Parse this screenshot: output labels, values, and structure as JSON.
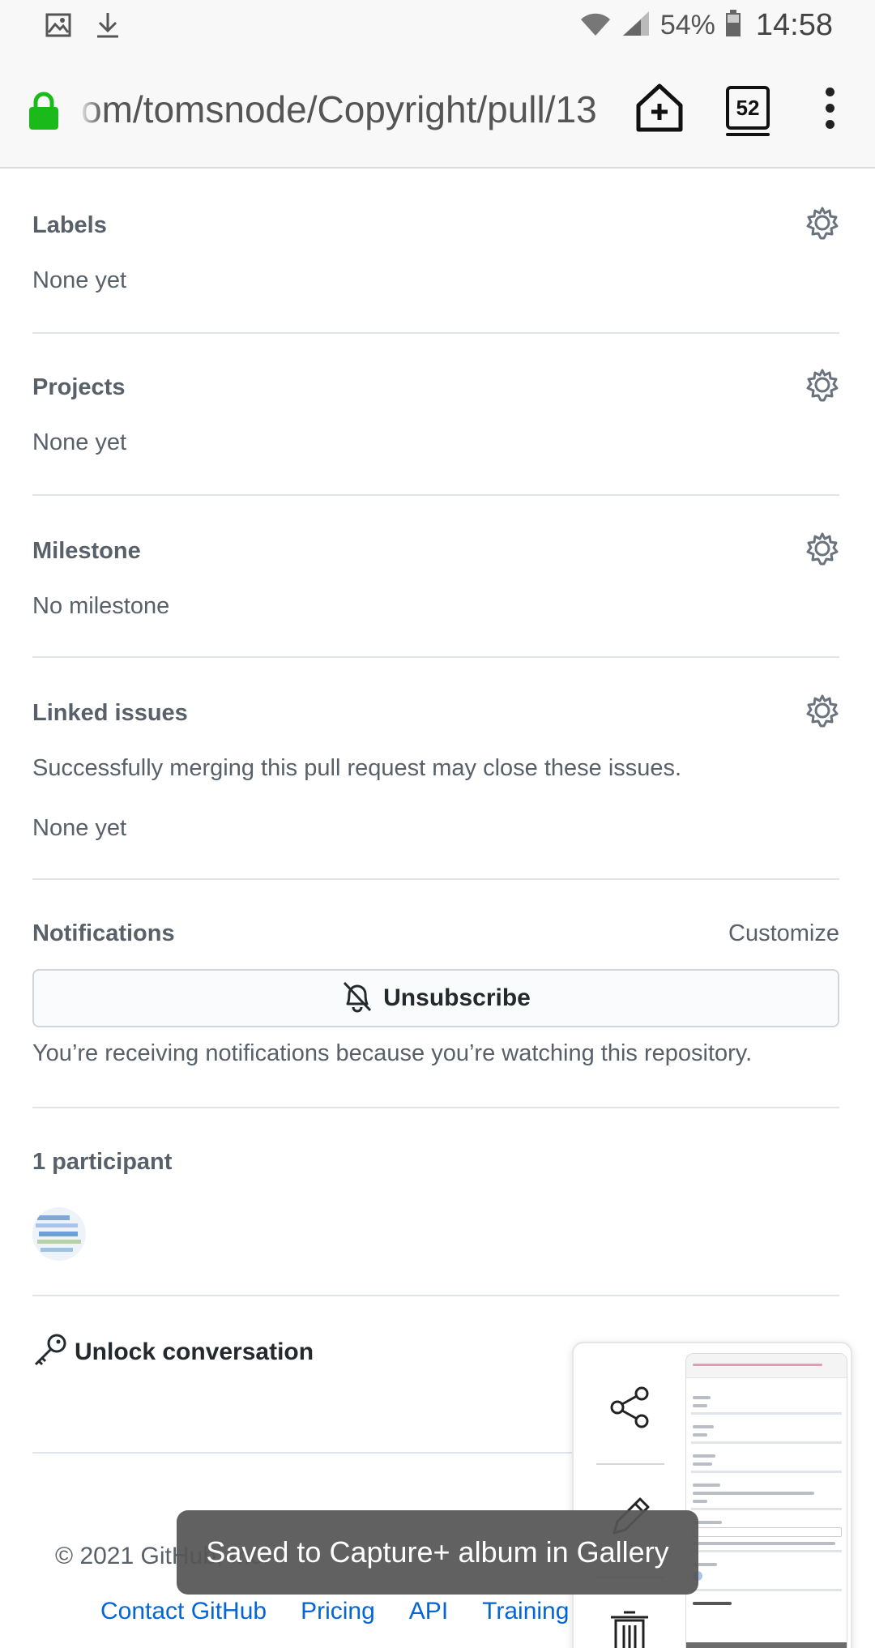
{
  "status_bar": {
    "battery_percent": "54%",
    "time": "14:58",
    "left_icons": [
      "image-icon",
      "download-icon"
    ],
    "right_icons": [
      "wifi-icon",
      "signal-icon",
      "battery-icon"
    ]
  },
  "browser": {
    "url": "om/tomsnode/Copyright/pull/13",
    "tab_count": "52",
    "secure_color": "#1aba1a"
  },
  "sidebar": {
    "labels": {
      "heading": "Labels",
      "value": "None yet"
    },
    "projects": {
      "heading": "Projects",
      "value": "None yet"
    },
    "milestone": {
      "heading": "Milestone",
      "value": "No milestone"
    },
    "linked_issues": {
      "heading": "Linked issues",
      "description": "Successfully merging this pull request may close these issues.",
      "value": "None yet"
    },
    "notifications": {
      "heading": "Notifications",
      "customize_label": "Customize",
      "unsubscribe_label": "Unsubscribe",
      "reason": "You’re receiving notifications because you’re watching this repository."
    },
    "participants": {
      "heading": "1 participant"
    },
    "unlock": {
      "label": "Unlock conversation"
    }
  },
  "footer": {
    "copyright": "© 2021 GitHub, Inc.",
    "links": [
      "Contact GitHub",
      "Pricing",
      "API",
      "Training"
    ]
  },
  "toast": {
    "message": "Saved to Capture+ album in Gallery"
  },
  "colors": {
    "link": "#0366d6",
    "muted_text": "#586069",
    "border": "#e1e4e8"
  }
}
